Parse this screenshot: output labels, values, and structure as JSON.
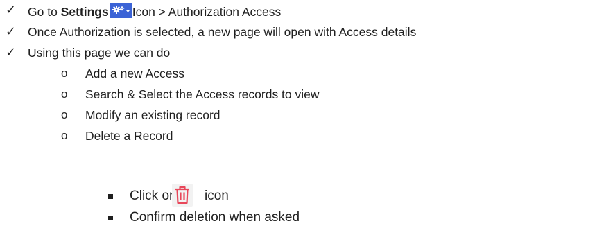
{
  "checklist": {
    "item1": {
      "prefix": "Go to ",
      "settings_label": "Settings",
      "settings_icon": "gear-dropdown-icon",
      "suffix": "Icon > Authorization Access"
    },
    "item2": "Once Authorization is selected, a new page will open with Access details",
    "item3": "Using this page we can do"
  },
  "actions": [
    "Add a new Access",
    "Search & Select the Access records to view",
    "Modify an existing record",
    "Delete a Record"
  ],
  "delete_steps": {
    "step1_prefix": "Click on",
    "step1_icon": "trash-icon",
    "step1_suffix": "icon",
    "step2": "Confirm deletion when asked"
  },
  "colors": {
    "settings_button": "#3b63d6",
    "trash_icon": "#e8475a"
  }
}
